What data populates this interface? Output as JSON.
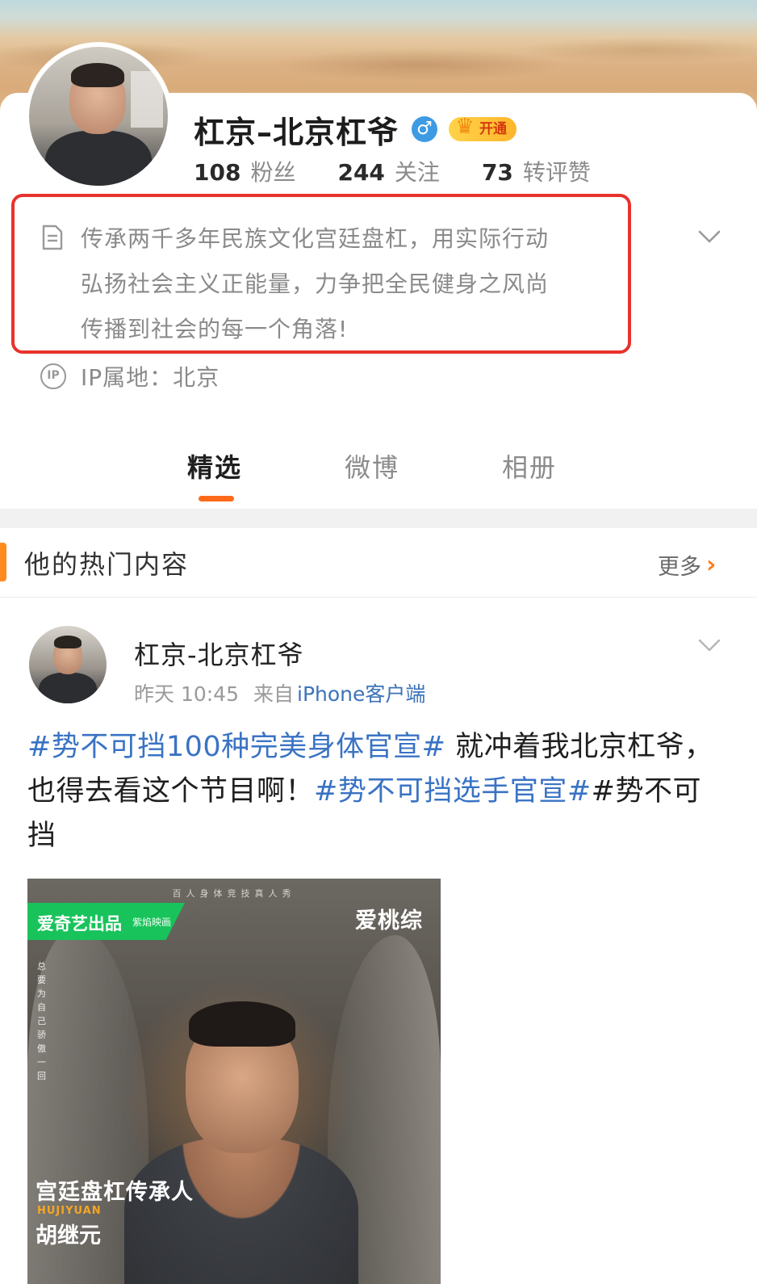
{
  "profile": {
    "name": "杠京–北京杠爷",
    "gender_symbol": "♂",
    "vip_label": "开通",
    "stats": [
      {
        "num": "108",
        "label": "粉丝"
      },
      {
        "num": "244",
        "label": "关注"
      },
      {
        "num": "73",
        "label": "转评赞"
      }
    ],
    "bio_lines": [
      "传承两千多年民族文化宫廷盘杠，用实际行动",
      "弘扬社会主义正能量，力争把全民健身之风尚",
      "传播到社会的每一个角落!"
    ],
    "ip_icon_text": "IP",
    "ip_location": "IP属地：北京"
  },
  "tabs": [
    {
      "label": "精选",
      "active": true
    },
    {
      "label": "微博",
      "active": false
    },
    {
      "label": "相册",
      "active": false
    }
  ],
  "hot_section": {
    "title": "他的热门内容",
    "more_label": "更多",
    "more_arrow": "›"
  },
  "post": {
    "author": "杠京-北京杠爷",
    "time": "昨天 10:45",
    "source_prefix": "来自",
    "source": "iPhone客户端",
    "text_parts": [
      {
        "text": "#势不可挡100种完美身体官宣#",
        "topic": true
      },
      {
        "text": " 就冲着我北京杠爷，也得去看这个节目啊！",
        "topic": false
      },
      {
        "text": "#势不可挡选手官宣#",
        "topic": true
      },
      {
        "text": "#势不可挡",
        "topic": false
      }
    ],
    "image": {
      "tagline": "百人身体竞技真人秀",
      "brand_a": "爱奇艺出品",
      "brand_b": "紫焰映画",
      "logo": "爱桃综",
      "vertical_text": "总要为自己骄傲一回",
      "title": "宫廷盘杠传承人",
      "pinyin": "HUJIYUAN",
      "person_name": "胡继元"
    }
  },
  "colors": {
    "accent_orange": "#ff6a1a",
    "topic_blue": "#3a73c4",
    "highlight_red": "#e8322c",
    "gender_blue": "#3d9be3"
  }
}
